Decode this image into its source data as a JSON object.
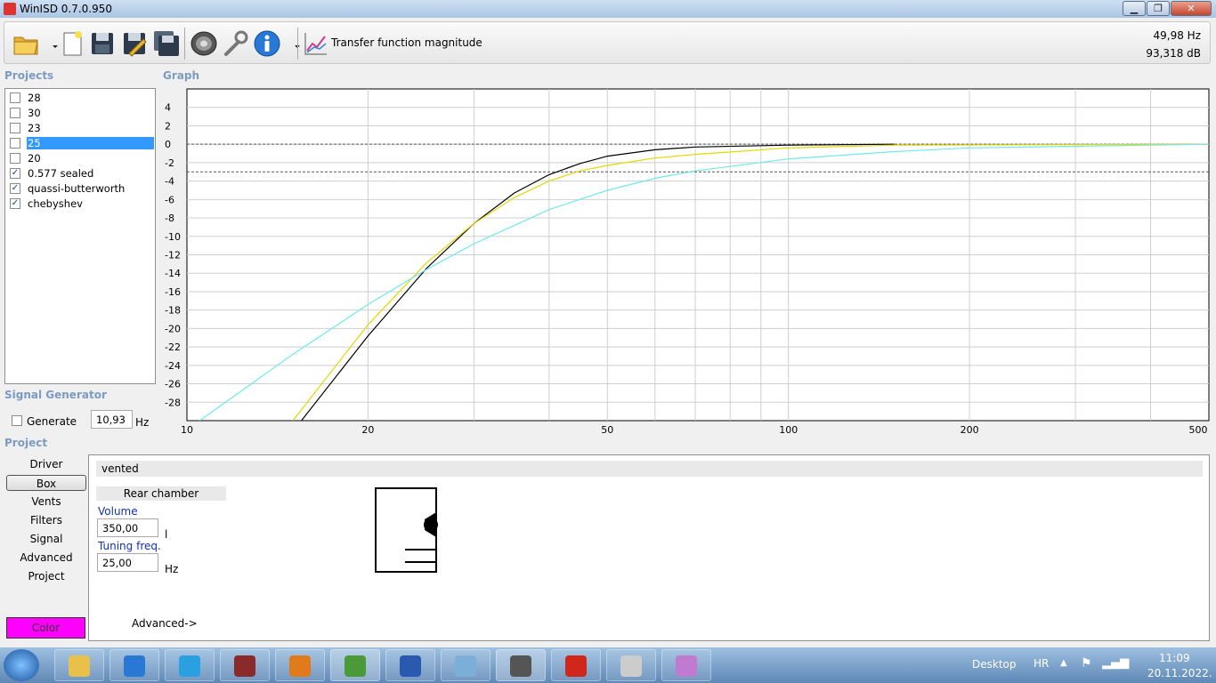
{
  "window": {
    "title": "WinISD 0.7.0.950",
    "minimize": "▁",
    "maximize": "❐",
    "close": "✕"
  },
  "toolbar": {
    "graph_title": "Transfer function magnitude",
    "readout_freq": "49,98 Hz",
    "readout_level": "93,318 dB",
    "icons": [
      "open-folder-icon",
      "new-document-icon",
      "save-icon",
      "save-as-icon",
      "save-all-icon",
      "driver-icon",
      "tools-icon",
      "info-icon",
      "chart-icon"
    ]
  },
  "projects": {
    "heading": "Projects",
    "items": [
      {
        "label": "28",
        "checked": false,
        "selected": false
      },
      {
        "label": "30",
        "checked": false,
        "selected": false
      },
      {
        "label": "23",
        "checked": false,
        "selected": false
      },
      {
        "label": "25",
        "checked": false,
        "selected": true
      },
      {
        "label": "20",
        "checked": false,
        "selected": false
      },
      {
        "label": "0.577 sealed",
        "checked": true,
        "selected": false
      },
      {
        "label": "quassi-butterworth",
        "checked": true,
        "selected": false
      },
      {
        "label": "chebyshev",
        "checked": true,
        "selected": false
      }
    ]
  },
  "graph": {
    "heading": "Graph"
  },
  "chart_data": {
    "type": "line",
    "title": "",
    "xlabel": "",
    "ylabel": "",
    "x_scale": "log",
    "xlim": [
      10,
      500
    ],
    "ylim": [
      -30,
      6
    ],
    "x_ticks": [
      10,
      20,
      50,
      100,
      200,
      500
    ],
    "x_tick_labels": [
      "10",
      "20",
      "50",
      "100",
      "200",
      "500"
    ],
    "y_ticks": [
      4,
      2,
      0,
      -2,
      -4,
      -6,
      -8,
      -10,
      -12,
      -14,
      -16,
      -18,
      -20,
      -22,
      -24,
      -26,
      -28
    ],
    "y_tick_labels": [
      "4",
      "2",
      "0",
      "-2",
      "-4",
      "-6",
      "-8",
      "-10",
      "-12",
      "-14",
      "-16",
      "-18",
      "-20",
      "-22",
      "-24",
      "-26",
      "-28"
    ],
    "reference_lines": [
      0,
      -3
    ],
    "grid": true,
    "series": [
      {
        "color": "#000000",
        "x": [
          15.5,
          20,
          25,
          30,
          35,
          40,
          45,
          50,
          60,
          70,
          100,
          150
        ],
        "y": [
          -30,
          -20.8,
          -13.5,
          -8.6,
          -5.3,
          -3.3,
          -2.1,
          -1.3,
          -0.6,
          -0.3,
          -0.1,
          0
        ]
      },
      {
        "color": "#e6d700",
        "x": [
          15,
          20,
          25,
          30,
          35,
          40,
          45,
          50,
          60,
          70,
          100,
          150,
          500
        ],
        "y": [
          -30,
          -19.6,
          -12.9,
          -8.6,
          -5.8,
          -4.0,
          -2.9,
          -2.3,
          -1.5,
          -1.1,
          -0.4,
          -0.1,
          0
        ]
      },
      {
        "color": "#6fe8ee",
        "x": [
          10.5,
          15,
          20,
          25,
          30,
          40,
          50,
          60,
          70,
          100,
          150,
          200,
          500
        ],
        "y": [
          -30,
          -22.8,
          -17.4,
          -13.6,
          -10.8,
          -7.1,
          -5.0,
          -3.7,
          -2.9,
          -1.6,
          -0.8,
          -0.4,
          0
        ]
      }
    ]
  },
  "signal_generator": {
    "heading": "Signal Generator",
    "generate_label": "Generate",
    "generate_checked": false,
    "frequency": "10,93",
    "unit": "Hz"
  },
  "project": {
    "heading": "Project",
    "nav": [
      "Driver",
      "Box",
      "Vents",
      "Filters",
      "Signal",
      "Advanced",
      "Project"
    ],
    "active_nav": "Box",
    "box_type": "vented",
    "rear_chamber_label": "Rear chamber",
    "volume_label": "Volume",
    "volume_value": "350,00",
    "volume_unit": "l",
    "tuning_label": "Tuning freq.",
    "tuning_value": "25,00",
    "tuning_unit": "Hz",
    "advanced_link": "Advanced->",
    "color_label": "Color",
    "color_value": "#ff00ff"
  },
  "taskbar": {
    "apps": [
      "start-orb-icon",
      "explorer-icon",
      "ie-icon",
      "skype-icon",
      "winrar-icon",
      "media-player-icon",
      "chrome-icon",
      "word-icon",
      "notepad-icon",
      "winisd-icon",
      "pdf-icon",
      "calculator-icon",
      "paint-icon"
    ],
    "desktop_label": "Desktop",
    "lang": "HR",
    "time": "11:09",
    "date": "20.11.2022."
  }
}
